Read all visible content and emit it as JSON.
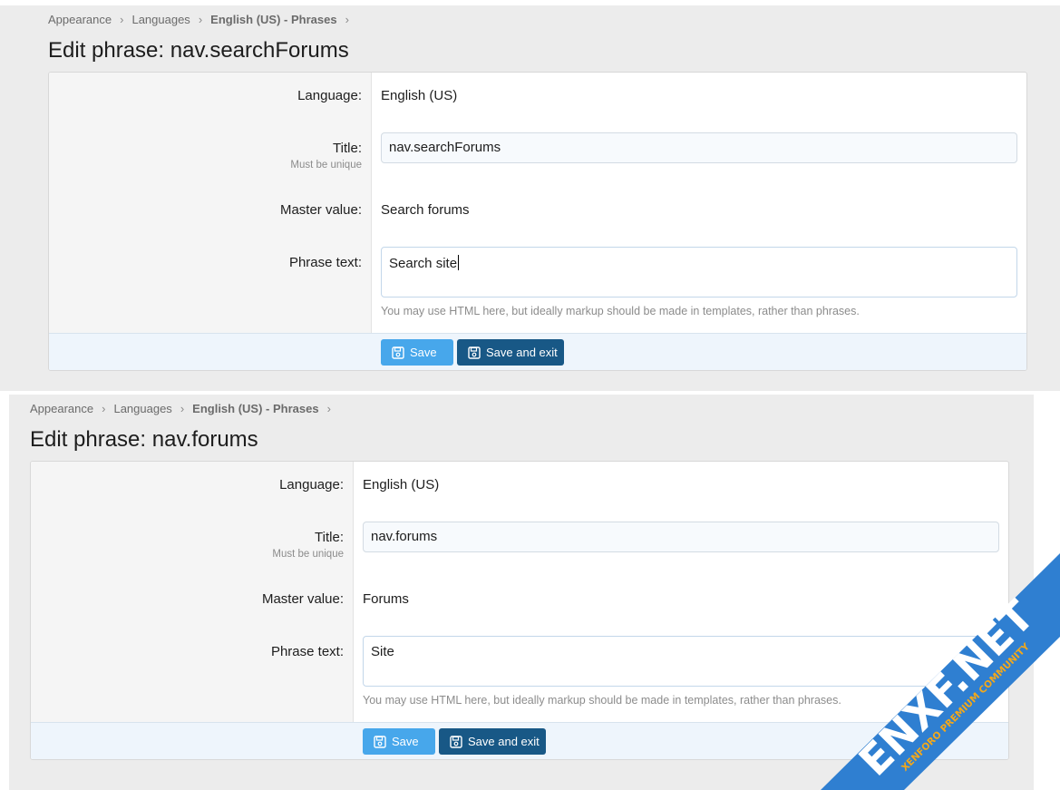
{
  "panels": [
    {
      "breadcrumb": [
        "Appearance",
        "Languages",
        "English (US) - Phrases"
      ],
      "title": "Edit phrase: nav.searchForums",
      "form": {
        "language_label": "Language:",
        "language_value": "English (US)",
        "title_label": "Title:",
        "title_hint": "Must be unique",
        "title_value": "nav.searchForums",
        "master_label": "Master value:",
        "master_value": "Search forums",
        "phrase_label": "Phrase text:",
        "phrase_value": "Search site",
        "phrase_explain": "You may use HTML here, but ideally markup should be made in templates, rather than phrases."
      },
      "buttons": {
        "save": "Save",
        "save_exit": "Save and exit"
      }
    },
    {
      "breadcrumb": [
        "Appearance",
        "Languages",
        "English (US) - Phrases"
      ],
      "title": "Edit phrase: nav.forums",
      "form": {
        "language_label": "Language:",
        "language_value": "English (US)",
        "title_label": "Title:",
        "title_hint": "Must be unique",
        "title_value": "nav.forums",
        "master_label": "Master value:",
        "master_value": "Forums",
        "phrase_label": "Phrase text:",
        "phrase_value": "Site",
        "phrase_explain": "You may use HTML here, but ideally markup should be made in templates, rather than phrases."
      },
      "buttons": {
        "save": "Save",
        "save_exit": "Save and exit"
      }
    }
  ],
  "watermark": {
    "brand": "ENXF.NET",
    "tagline": "XENFORO PREMIUM COMMUNITY",
    "colors": {
      "band": "#2f7fd1",
      "text": "#ffffff",
      "tagline": "#f3a81a"
    }
  },
  "icons": [
    "chevron-right-icon",
    "save-icon"
  ],
  "colors": {
    "primary_button": "#47a7eb",
    "secondary_button": "#185886",
    "footer_bg": "#eef5fc"
  }
}
